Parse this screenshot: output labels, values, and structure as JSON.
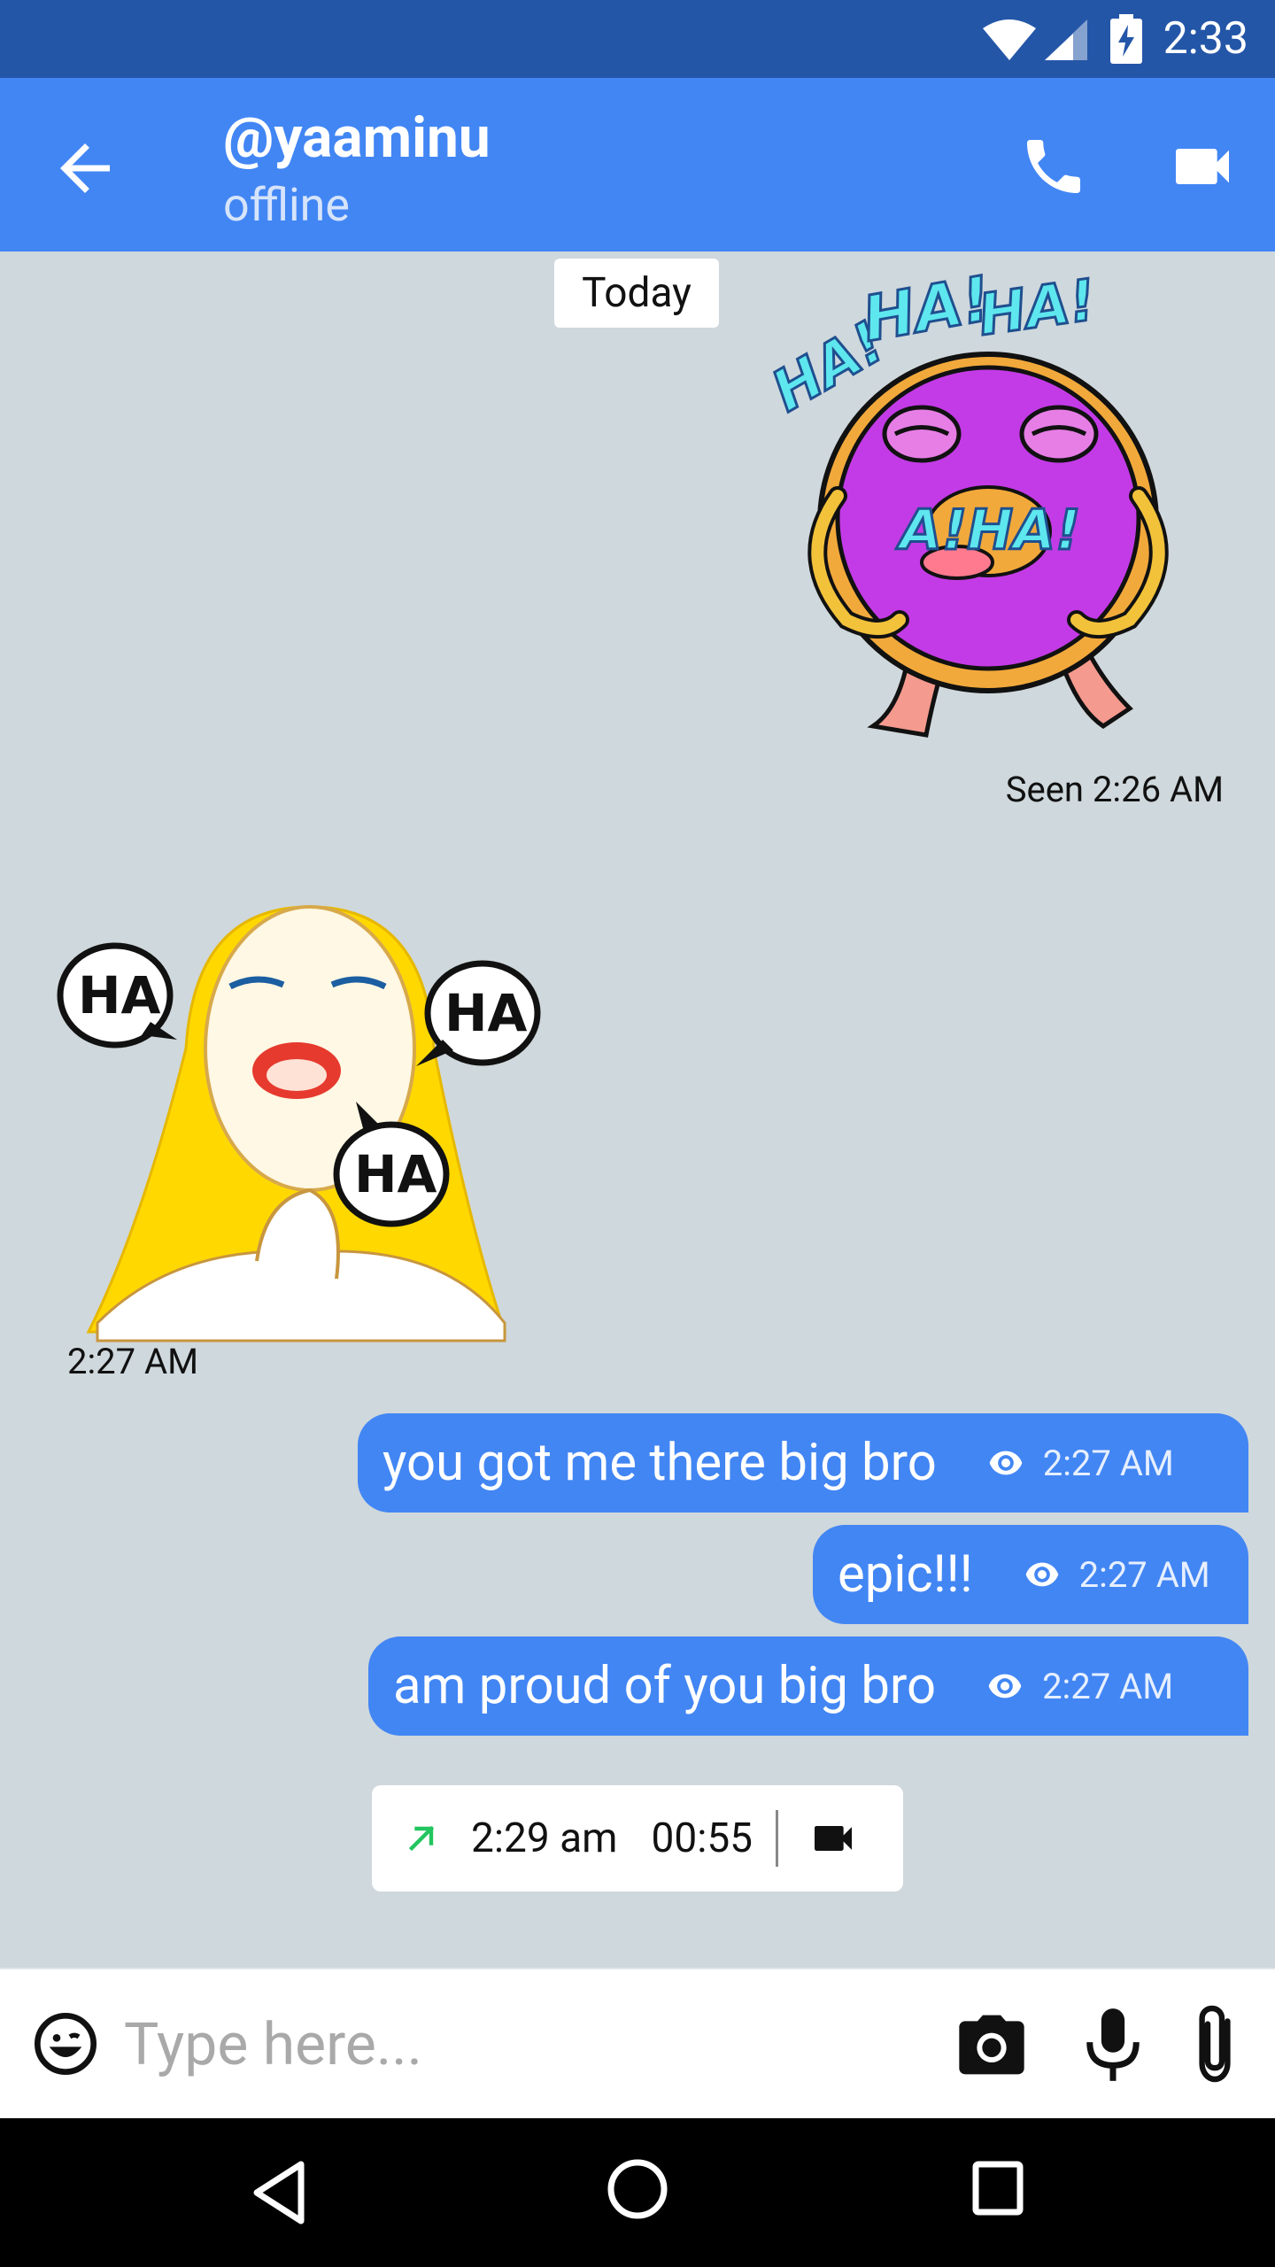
{
  "status_bar": {
    "time": "2:33"
  },
  "header": {
    "contact_name": "@yaaminu",
    "contact_status": "offline"
  },
  "chat": {
    "date_label": "Today",
    "sent_sticker": {
      "sticker_text": "HA! HA! HA! A!HA!",
      "status_time": "Seen  2:26 AM"
    },
    "received_sticker": {
      "sticker_text": "HA HA HA",
      "time": "2:27 AM"
    },
    "messages": [
      {
        "text": "you got me there big bro",
        "time": "2:27 AM",
        "icon": "eye-icon"
      },
      {
        "text": "epic!!!",
        "time": "2:27 AM",
        "icon": "eye-icon"
      },
      {
        "text": "am proud of you big bro",
        "time": "2:27 AM",
        "icon": "eye-icon"
      }
    ],
    "call_log": {
      "time": "2:29 am",
      "duration": "00:55",
      "direction": "outgoing",
      "type": "video"
    }
  },
  "composer": {
    "placeholder": "Type here..."
  },
  "colors": {
    "status_bar": "#2456a8",
    "app_bar": "#4286f4",
    "bubble": "#4286f4",
    "chat_bg": "#cfd8dc",
    "call_arrow": "#22c55e"
  }
}
